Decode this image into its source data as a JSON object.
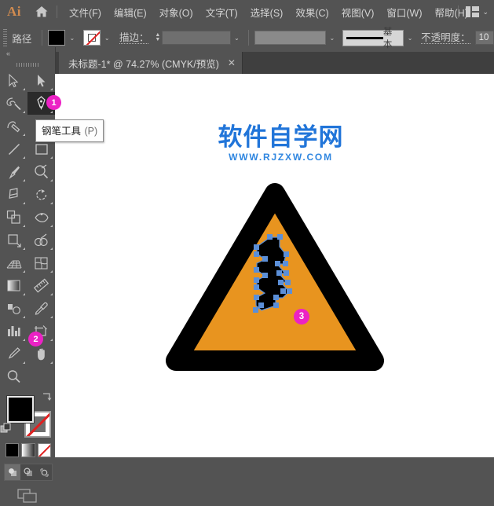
{
  "app": {
    "name": "Ai",
    "home_icon": "home-icon",
    "workspace_icon": "workspace-layout-icon",
    "workspace_caret": "⌄"
  },
  "menubar": {
    "items": [
      {
        "label": "文件(F)",
        "name": "menu-file"
      },
      {
        "label": "编辑(E)",
        "name": "menu-edit"
      },
      {
        "label": "对象(O)",
        "name": "menu-object"
      },
      {
        "label": "文字(T)",
        "name": "menu-type"
      },
      {
        "label": "选择(S)",
        "name": "menu-select"
      },
      {
        "label": "效果(C)",
        "name": "menu-effect"
      },
      {
        "label": "视图(V)",
        "name": "menu-view"
      },
      {
        "label": "窗口(W)",
        "name": "menu-window"
      },
      {
        "label": "帮助(H)",
        "name": "menu-help"
      }
    ]
  },
  "controlbar": {
    "context_label": "路径",
    "fill_swatch_color": "#000000",
    "fill_caret": "⌄",
    "stroke_swatch": "none",
    "stroke_caret": "⌄",
    "stroke_label": "描边：",
    "stroke_weight_value": "",
    "stroke_weight_caret": "⌄",
    "variable_width_value": "",
    "variable_width_caret": "⌄",
    "brush_style_label": "基本",
    "brush_caret": "⌄",
    "opacity_label": "不透明度：",
    "opacity_value": "10"
  },
  "tabs": {
    "document": {
      "title": "未标题-1* @ 74.27% (CMYK/预览)",
      "close": "✕"
    }
  },
  "toolbar": {
    "collapse": "«",
    "tools": [
      {
        "name": "selection-tool",
        "label": "选择工具"
      },
      {
        "name": "direct-selection-tool",
        "label": "直接选择工具"
      },
      {
        "name": "magic-wand-tool",
        "label": "魔棒工具"
      },
      {
        "name": "pen-tool",
        "label": "钢笔工具"
      },
      {
        "name": "curvature-tool",
        "label": "曲率工具"
      },
      {
        "name": "type-tool",
        "label": "文字工具"
      },
      {
        "name": "line-segment-tool",
        "label": "直线段工具"
      },
      {
        "name": "rectangle-tool",
        "label": "矩形工具"
      },
      {
        "name": "paintbrush-tool",
        "label": "画笔工具"
      },
      {
        "name": "shaper-tool",
        "label": "Shaper 工具"
      },
      {
        "name": "eraser-tool",
        "label": "橡皮擦工具"
      },
      {
        "name": "rotate-tool",
        "label": "旋转工具"
      },
      {
        "name": "scale-tool",
        "label": "缩放工具"
      },
      {
        "name": "width-tool",
        "label": "宽度工具"
      },
      {
        "name": "free-transform-tool",
        "label": "自由变换工具"
      },
      {
        "name": "shape-builder-tool",
        "label": "形状生成器工具"
      },
      {
        "name": "perspective-grid-tool",
        "label": "透视网格工具"
      },
      {
        "name": "mesh-tool",
        "label": "网格工具"
      },
      {
        "name": "gradient-tool",
        "label": "渐变工具"
      },
      {
        "name": "measure-tool",
        "label": "度量工具"
      },
      {
        "name": "blend-tool",
        "label": "混合工具"
      },
      {
        "name": "eyedropper-tool",
        "label": "吸管工具"
      },
      {
        "name": "column-graph-tool",
        "label": "柱形图工具"
      },
      {
        "name": "artboard-tool",
        "label": "画板工具"
      },
      {
        "name": "slice-tool",
        "label": "切片工具"
      },
      {
        "name": "hand-tool",
        "label": "抓手工具"
      },
      {
        "name": "zoom-tool",
        "label": "缩放工具"
      }
    ],
    "fill_color": "#000000",
    "stroke_color": "none",
    "color_modes": [
      {
        "name": "color-mode-solid",
        "label": "颜色"
      },
      {
        "name": "color-mode-gradient",
        "label": "渐变"
      },
      {
        "name": "color-mode-none",
        "label": "无"
      }
    ],
    "draw_modes": [
      {
        "name": "draw-normal",
        "label": "正常绘图"
      },
      {
        "name": "draw-behind",
        "label": "背面绘图"
      },
      {
        "name": "draw-inside",
        "label": "内部绘图"
      }
    ],
    "screen_mode": "更改屏幕模式"
  },
  "tooltip": {
    "name": "钢笔工具",
    "shortcut": "(P)"
  },
  "canvas": {
    "watermark_cn": "软件自学网",
    "watermark_en": "WWW.RJZXW.COM",
    "watermark_color": "#2175d9",
    "artwork": {
      "name": "warning-triangle-sign",
      "fill_color": "#e8941f",
      "border_color": "#000000",
      "bolt_color": "#000000",
      "anchor_color": "#5b8fd8"
    }
  },
  "badges": [
    {
      "number": "1",
      "name": "callout-badge-1",
      "color": "#ec22c5"
    },
    {
      "number": "2",
      "name": "callout-badge-2",
      "color": "#ec22c5"
    },
    {
      "number": "3",
      "name": "callout-badge-3",
      "color": "#ec22c5"
    }
  ]
}
